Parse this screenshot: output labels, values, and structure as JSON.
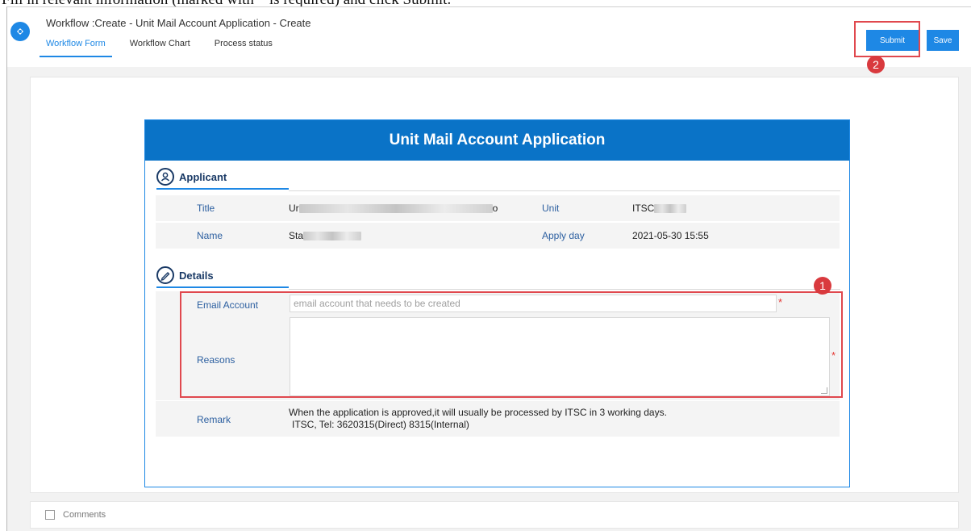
{
  "caption": "Fill in relevant information (marked with * is required) and click Submit.",
  "header": {
    "title": "Workflow :Create - Unit Mail Account Application - Create",
    "tabs": [
      {
        "label": "Workflow Form",
        "active": true
      },
      {
        "label": "Workflow Chart",
        "active": false
      },
      {
        "label": "Process status",
        "active": false
      }
    ],
    "submit_label": "Submit",
    "save_label": "Save"
  },
  "annotations": {
    "badge_1": "1",
    "badge_2": "2"
  },
  "form": {
    "title": "Unit Mail Account Application",
    "applicant": {
      "heading": "Applicant",
      "title_label": "Title",
      "title_value_prefix": "Ur",
      "title_value_suffix": "o",
      "unit_label": "Unit",
      "unit_value": "ITSC",
      "name_label": "Name",
      "name_value": "Sta",
      "apply_day_label": "Apply day",
      "apply_day_value": "2021-05-30 15:55"
    },
    "details": {
      "heading": "Details",
      "email_label": "Email Account",
      "email_placeholder": "email account that needs to be created",
      "email_value": "",
      "reasons_label": "Reasons",
      "reasons_value": "",
      "required_mark": "*",
      "remark_label": "Remark",
      "remark_line1": "When the application is approved,it will usually be processed by ITSC in 3 working days.",
      "remark_line2": "ITSC, Tel: 3620315(Direct) 8315(Internal)"
    }
  },
  "comments": {
    "label": "Comments"
  },
  "colors": {
    "accent": "#1e88e5",
    "header_bar": "#0a73c7",
    "annotation": "#e0484e"
  }
}
